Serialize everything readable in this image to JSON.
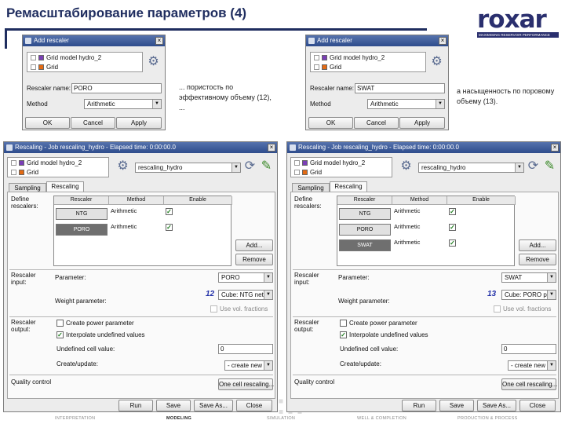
{
  "slide": {
    "title": "Ремасштабирование параметров (4)"
  },
  "logo": {
    "name": "roxar",
    "tagline": "MAXIMISING RESERVOIR PERFORMANCE"
  },
  "notes": {
    "left": "... пористость по эффективному объему (12), ...",
    "right": "а насыщенность по поровому объему (13)."
  },
  "add_left": {
    "title": "Add rescaler",
    "objects": [
      "Grid model hydro_2",
      "Grid"
    ],
    "name_label": "Rescaler name:",
    "name_value": "PORO",
    "method_label": "Method",
    "method_value": "Arithmetic",
    "buttons": [
      "OK",
      "Cancel",
      "Apply"
    ]
  },
  "add_right": {
    "title": "Add rescaler",
    "objects": [
      "Grid model hydro_2",
      "Grid"
    ],
    "name_label": "Rescaler name:",
    "name_value": "SWAT",
    "method_label": "Method",
    "method_value": "Arithmetic",
    "buttons": [
      "OK",
      "Cancel",
      "Apply"
    ]
  },
  "resc_left": {
    "title": "Rescaling - Job rescaling_hydro - Elapsed time: 0:00:00.0",
    "objects": [
      "Grid model hydro_2",
      "Grid"
    ],
    "job": "rescaling_hydro",
    "tabs": [
      "Sampling",
      "Rescaling"
    ],
    "define_label": "Define rescalers:",
    "grid_headers": [
      "Rescaler",
      "Method",
      "Enable"
    ],
    "rows": [
      {
        "name": "NTG",
        "method": "Arithmetic",
        "enabled": true,
        "dark": false
      },
      {
        "name": "PORO",
        "method": "Arithmetic",
        "enabled": true,
        "dark": true
      }
    ],
    "add_btn": "Add...",
    "remove_btn": "Remove",
    "input_label": "Rescaler input:",
    "param_label": "Parameter:",
    "param_value": "PORO",
    "weight_label": "Weight parameter:",
    "weight_value": "Cube: NTG net",
    "weight_num": "12",
    "use_volfrac": "Use vol. fractions",
    "output_label": "Rescaler output:",
    "create_power": "Create power parameter",
    "interpolate": "Interpolate undefined values",
    "undefined_label": "Undefined cell value:",
    "undefined_value": "0",
    "create_label": "Create/update:",
    "create_value": "- create new -",
    "quality_label": "Quality control",
    "one_cell": "One cell rescaling...",
    "footer": [
      "Run",
      "Save",
      "Save As...",
      "Close"
    ]
  },
  "resc_right": {
    "title": "Rescaling - Job rescaling_hydro - Elapsed time: 0:00:00.0",
    "objects": [
      "Grid model hydro_2",
      "Grid"
    ],
    "job": "rescaling_hydro",
    "tabs": [
      "Sampling",
      "Rescaling"
    ],
    "define_label": "Define rescalers:",
    "grid_headers": [
      "Rescaler",
      "Method",
      "Enable"
    ],
    "rows": [
      {
        "name": "NTG",
        "method": "Arithmetic",
        "enabled": true,
        "dark": false
      },
      {
        "name": "PORO",
        "method": "Arithmetic",
        "enabled": true,
        "dark": false
      },
      {
        "name": "SWAT",
        "method": "Arithmetic",
        "enabled": true,
        "dark": true
      }
    ],
    "add_btn": "Add...",
    "remove_btn": "Remove",
    "input_label": "Rescaler input:",
    "param_label": "Parameter:",
    "param_value": "SWAT",
    "weight_label": "Weight parameter:",
    "weight_value": "Cube: PORO pore",
    "weight_num": "13",
    "use_volfrac": "Use vol. fractions",
    "output_label": "Rescaler output:",
    "create_power": "Create power parameter",
    "interpolate": "Interpolate undefined values",
    "undefined_label": "Undefined cell value:",
    "undefined_value": "0",
    "create_label": "Create/update:",
    "create_value": "- create new -",
    "quality_label": "Quality control",
    "one_cell": "One cell rescaling...",
    "footer": [
      "Run",
      "Save",
      "Save As...",
      "Close"
    ]
  },
  "footer_nav": [
    "INTERPRETATION",
    "MODELING",
    "SIMULATION",
    "WELL & COMPLETION",
    "PRODUCTION & PROCESS"
  ],
  "footer_active": 1
}
